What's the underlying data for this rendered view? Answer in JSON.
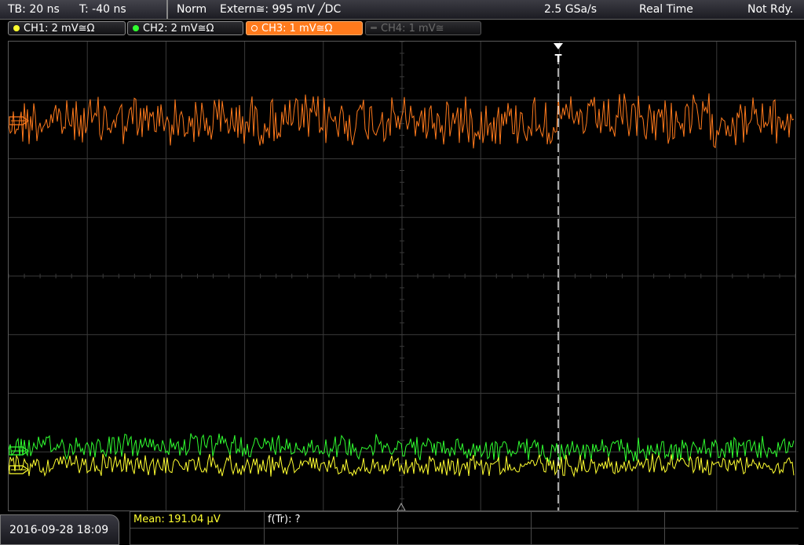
{
  "status": {
    "timebase": "TB: 20 ns",
    "trigger_time": "T: -40 ns",
    "trigger_mode": "Norm",
    "trigger_source": "Extern≅: 995 mV ╱DC",
    "sample_rate": "2.5 GSa/s",
    "acq_mode": "Real Time",
    "state": "Not Rdy."
  },
  "channels": [
    {
      "label": "CH1: 2 mV≅Ω",
      "color": "#ffff30",
      "state": "on"
    },
    {
      "label": "CH2: 2 mV≅Ω",
      "color": "#30ff30",
      "state": "on"
    },
    {
      "label": "CH3: 1 mV≅Ω",
      "color": "#ff7a1c",
      "state": "active"
    },
    {
      "label": "CH4: 1 mV≅",
      "color": "#6a6a6a",
      "state": "off"
    }
  ],
  "trigger_marker": "T",
  "datetime": "2016-09-28 18:09",
  "measurements": {
    "mean": "Mean: 191.04 µV",
    "ftr": "f(Tr): ?"
  },
  "colors": {
    "ch1": "#ffff30",
    "ch2": "#30ff30",
    "ch3": "#ff7a1c",
    "grid": "#3a3a3a"
  }
}
